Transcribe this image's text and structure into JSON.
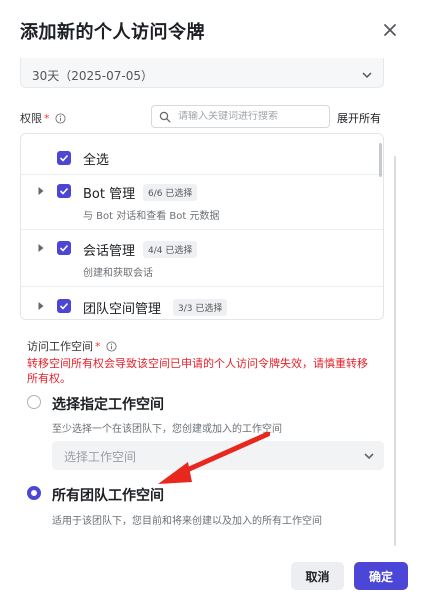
{
  "dialog": {
    "title": "添加新的个人访问令牌",
    "close_icon": "close-icon"
  },
  "expiry": {
    "value": "30天（2025-07-05）",
    "icon": "chevron-down-icon"
  },
  "permissions": {
    "label": "权限",
    "required_mark": "*",
    "info_icon": "info-icon",
    "search_placeholder": "请输入关键词进行搜索",
    "search_icon": "search-icon",
    "expand_all": "展开所有",
    "select_all": "全选",
    "items": [
      {
        "name": "Bot 管理",
        "badge": "6/6 已选择",
        "desc": "与 Bot 对话和查看 Bot 元数据"
      },
      {
        "name": "会话管理",
        "badge": "4/4 已选择",
        "desc": "创建和获取会话"
      },
      {
        "name": "团队空间管理",
        "badge": "3/3 已选择",
        "desc": ""
      }
    ]
  },
  "workspace": {
    "label": "访问工作空间",
    "required_mark": "*",
    "warning": "转移空间所有权会导致该空间已申请的个人访问令牌失效，请慎重转移所有权。",
    "option_specific": {
      "label": "选择指定工作空间",
      "desc": "至少选择一个在该团队下，您创建或加入的工作空间",
      "select_placeholder": "选择工作空间",
      "selected": false
    },
    "option_all": {
      "label": "所有团队工作空间",
      "desc": "适用于该团队下，您目前和将来创建以及加入的所有工作空间",
      "selected": true
    }
  },
  "annotation": {
    "arrow_color": "#e8271f"
  },
  "footer": {
    "cancel": "取消",
    "confirm": "确定"
  },
  "colors": {
    "accent": "#4c46d6",
    "warning": "#e6222b"
  }
}
